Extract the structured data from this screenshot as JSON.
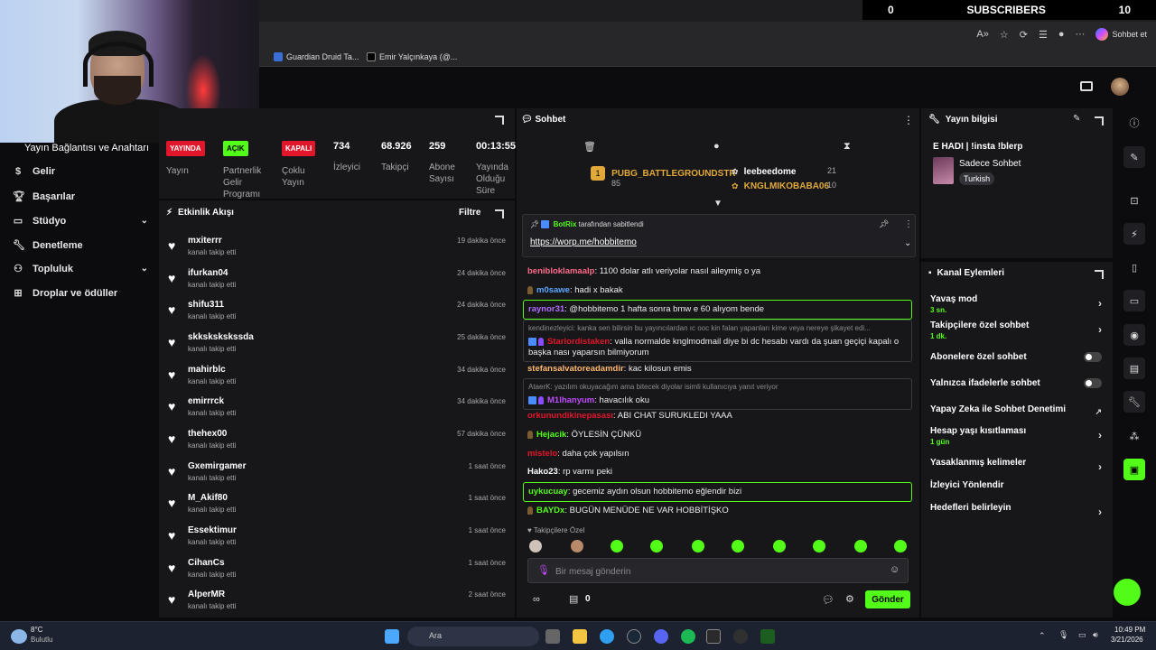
{
  "browser": {
    "subscribers_label": "SUBSCRIBERS",
    "subscribers_left": "0",
    "subscribers_right": "10",
    "bookmarks": [
      {
        "label": "Guardian Druid Ta..."
      },
      {
        "label": "Emir Yalçınkaya (@..."
      }
    ],
    "chat_button": "Sohbet et"
  },
  "leftnav": {
    "title": "Yayın Bağlantısı ve Anahtarı",
    "items": [
      {
        "label": "Gelir",
        "icon": "dollar-icon"
      },
      {
        "label": "Başarılar",
        "icon": "trophy-icon"
      },
      {
        "label": "Stüdyo",
        "icon": "studio-icon",
        "has_chevron": true
      },
      {
        "label": "Denetleme",
        "icon": "wrench-icon"
      },
      {
        "label": "Topluluk",
        "icon": "community-icon",
        "has_chevron": true
      },
      {
        "label": "Droplar ve ödüller",
        "icon": "gift-icon"
      }
    ]
  },
  "stats": [
    {
      "badge": "YAYINDA",
      "badge_color": "#e2162a",
      "label": "Yayın"
    },
    {
      "badge": "AÇIK",
      "badge_color": "#53fc18",
      "label": "Partnerlik Gelir Programı"
    },
    {
      "badge": "KAPALI",
      "badge_color": "#e2162a",
      "label": "Çoklu Yayın"
    },
    {
      "num": "734",
      "label": "İzleyici"
    },
    {
      "num": "68.926",
      "label": "Takipçi"
    },
    {
      "num": "259",
      "label": "Abone Sayısı"
    },
    {
      "num": "00:13:55",
      "label": "Yayında Olduğu Süre"
    }
  ],
  "feed": {
    "title": "Etkinlik Akışı",
    "filter": "Filtre",
    "rows": [
      {
        "name": "mxiterrr",
        "sub": "kanalı takip etti",
        "time": "19 dakika önce"
      },
      {
        "name": "ifurkan04",
        "sub": "kanalı takip etti",
        "time": "24 dakika önce"
      },
      {
        "name": "shifu311",
        "sub": "kanalı takip etti",
        "time": "24 dakika önce"
      },
      {
        "name": "skkskskskssda",
        "sub": "kanalı takip etti",
        "time": "25 dakika önce"
      },
      {
        "name": "mahirblc",
        "sub": "kanalı takip etti",
        "time": "34 dakika önce"
      },
      {
        "name": "emirrrck",
        "sub": "kanalı takip etti",
        "time": "34 dakika önce"
      },
      {
        "name": "thehex00",
        "sub": "kanalı takip etti",
        "time": "57 dakika önce"
      },
      {
        "name": "Gxemirgamer",
        "sub": "kanalı takip etti",
        "time": "1 saat önce"
      },
      {
        "name": "M_Akif80",
        "sub": "kanalı takip etti",
        "time": "1 saat önce"
      },
      {
        "name": "Essektimur",
        "sub": "kanalı takip etti",
        "time": "1 saat önce"
      },
      {
        "name": "CihanCs",
        "sub": "kanalı takip etti",
        "time": "1 saat önce"
      },
      {
        "name": "AlperMR",
        "sub": "kanalı takip etti",
        "time": "2 saat önce"
      }
    ]
  },
  "chat": {
    "title": "Sohbet",
    "leaders": [
      {
        "name": "PUBG_BATTLEGROUNDSTR",
        "count": "85",
        "color": "#e0a93a"
      },
      {
        "name": "leebeedome",
        "count": "21",
        "color": "#ffffff"
      },
      {
        "name": "KNGLMIKOBABA06",
        "count": "10",
        "color": "#e0a93a"
      }
    ],
    "pinned_by": "BotRix",
    "pinned_suffix": "tarafından sabitlendi",
    "pinned_link": "https://worp.me/hobbitemo",
    "messages": [
      {
        "user": "benibloklamaalp",
        "color": "#ff6b8a",
        "text": "1100 dolar atlı veriyolar nasıl aileymiş o ya"
      },
      {
        "user": "m0sawe",
        "color": "#5aa8ff",
        "text": "hadi x bakak"
      },
      {
        "user": "raynor31",
        "color": "#b06cff",
        "text": "@hobbitemo 1 hafta sonra bmw e 60 alıyom bende"
      },
      {
        "reply": "kendinezleyici: kanka sen bilirsin bu yayıncılardan ıc ooc kin falan yapanları kime veya nereye şikayet edi...",
        "user": "Starlordistaken",
        "color": "#e2162a",
        "text": "valla normalde knglmodmail diye bi dc hesabı vardı da şuan geçiçi kapalı o başka nası yaparsın bilmiyorum"
      },
      {
        "user": "stefansalvatoreadamdir",
        "color": "#ffb86b",
        "text": "kac kilosun emis"
      },
      {
        "reply": "AtaerK: yazılım okuyacağım ama bitecek diyolar isimli kullanıcıya yanıt veriyor",
        "user": "M1lhanyum",
        "color": "#c04cff",
        "text": "havacılık oku"
      },
      {
        "user": "orkunundikinepasası",
        "color": "#e2162a",
        "text": "ABI CHAT SURUKLEDI YAAA"
      },
      {
        "user": "Hejacik",
        "color": "#53fc18",
        "text": "ÖYLESİN ÇÜNKÜ"
      },
      {
        "user": "mistelo",
        "color": "#e2162a",
        "text": "daha çok yapılsın"
      },
      {
        "user": "Hako23",
        "color": "#ffffff",
        "text": "rp varmı peki"
      },
      {
        "user": "uykucuay",
        "color": "#53fc18",
        "text": "gecemiz aydın olsun hobbitemo eğlendir bizi"
      },
      {
        "user": "BAYDx",
        "color": "#53fc18",
        "text": "BUGÜN MENÜDE NE VAR HOBBİTİŞKO"
      }
    ],
    "followers_only": "Takipçilere Özel",
    "placeholder": "Bir mesaj gönderin",
    "points": "0",
    "send": "Gönder"
  },
  "info": {
    "title": "Yayın bilgisi",
    "stream_title": "E HADI | !insta !blerp",
    "category": "Sadece Sohbet",
    "language": "Turkish"
  },
  "actions": {
    "title": "Kanal Eylemleri",
    "rows": [
      {
        "label": "Yavaş mod",
        "sub": "3 sn.",
        "kind": "chevron"
      },
      {
        "label": "Takipçilere özel sohbet",
        "sub": "1 dk.",
        "kind": "chevron"
      },
      {
        "label": "Abonelere özel sohbet",
        "kind": "toggle"
      },
      {
        "label": "Yalnızca ifadelerle sohbet",
        "kind": "toggle"
      },
      {
        "label": "Yapay Zeka ile Sohbet Denetimi",
        "kind": "external"
      },
      {
        "label": "Hesap yaşı kısıtlaması",
        "sub": "1 gün",
        "kind": "chevron"
      },
      {
        "label": "Yasaklanmış kelimeler",
        "kind": "chevron"
      },
      {
        "label": "İzleyici Yönlendir",
        "kind": "none"
      },
      {
        "label": "Hedefleri belirleyin",
        "kind": "chevron"
      }
    ]
  },
  "taskbar": {
    "weather_temp": "8°C",
    "weather_desc": "Bulutlu",
    "search": "Ara",
    "time": "10:49 PM",
    "date": "3/21/2026"
  }
}
